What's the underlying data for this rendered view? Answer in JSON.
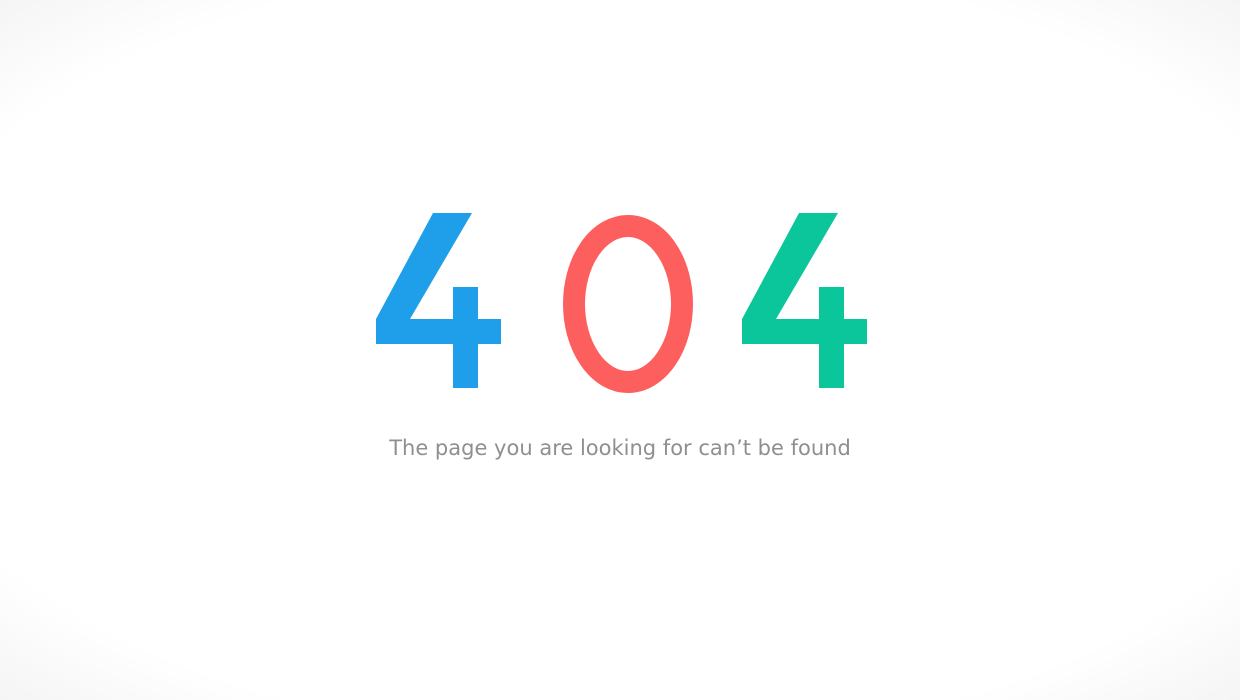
{
  "error": {
    "code_digits": [
      "4",
      "0",
      "4"
    ],
    "message": "The page you are looking for can’t be found"
  },
  "colors": {
    "digit_1": "#1f9fe9",
    "digit_2": "#fd5f5f",
    "digit_3": "#0bc69b",
    "message_text": "#8f8f8f",
    "background": "#ffffff",
    "vignette": "#e2e2e2"
  }
}
